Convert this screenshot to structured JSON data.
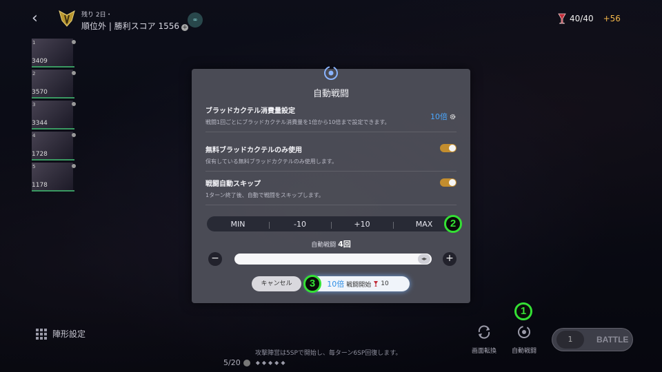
{
  "top": {
    "remaining": "残り 2日・",
    "rank_line": "順位外 | 勝利スコア 1556",
    "plus": "+",
    "infinite": "∞",
    "blood_count": "40/40",
    "blood_bonus": "+56"
  },
  "party": [
    {
      "num": "1",
      "score": "3409"
    },
    {
      "num": "2",
      "score": "3570"
    },
    {
      "num": "3",
      "score": "3344"
    },
    {
      "num": "4",
      "score": "1728"
    },
    {
      "num": "5",
      "score": "1178"
    }
  ],
  "dialog": {
    "title": "自動戦闘",
    "setting1_label": "ブラッドカクテル消費量設定",
    "setting1_desc": "戦闘1回ごとにブラッドカクテル消費量を1倍から10倍まで設定できます。",
    "setting1_value": "10倍",
    "setting2_label": "無料ブラッドカクテルのみ使用",
    "setting2_desc": "保有している無料ブラッドカクテルのみ使用します。",
    "setting3_label": "戦闘自動スキップ",
    "setting3_desc": "1ターン終了後、自動で戦闘をスキップします。",
    "steps": [
      "MIN",
      "-10",
      "+10",
      "MAX"
    ],
    "count_prefix": "自動戦闘",
    "count_value": "4回",
    "minus": "−",
    "plus": "+",
    "cancel": "キャンセル",
    "start_mult": "10倍",
    "start_label": "戦闘開始",
    "start_cost": "10"
  },
  "bottom": {
    "formation": "陣形設定",
    "hint": "攻撃陣営は5SPで開始し、毎ターン6SP回復します。",
    "turn": "5/20",
    "screen_rotate": "画面転換",
    "auto_battle": "自動戦闘",
    "battle_count": "1",
    "battle": "BATTLE"
  },
  "callouts": [
    "1",
    "2",
    "3"
  ],
  "colors": {
    "accent_blue": "#4aa8ff",
    "toggle_on": "#c38d2e",
    "blood_bonus": "#f2b64a",
    "callout_green": "#34e034"
  }
}
